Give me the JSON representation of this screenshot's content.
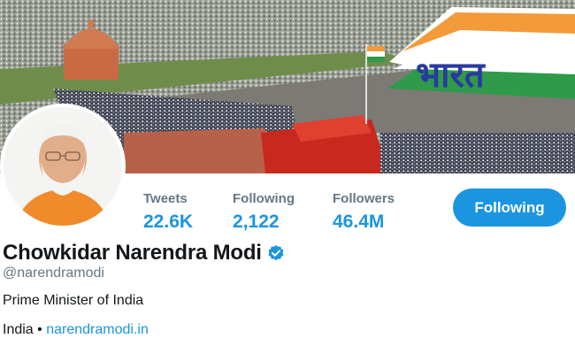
{
  "profile": {
    "display_name": "Chowkidar Narendra Modi",
    "handle": "@narendramodi",
    "bio": "Prime Minister of India",
    "location": "India",
    "separator": "•",
    "website": "narendramodi.in",
    "verified_icon": "verified-badge-icon",
    "banner_text": "भारत"
  },
  "stats": [
    {
      "label": "Tweets",
      "value": "22.6K"
    },
    {
      "label": "Following",
      "value": "2,122"
    },
    {
      "label": "Followers",
      "value": "46.4M"
    }
  ],
  "actions": {
    "follow_label": "Following"
  },
  "colors": {
    "accent": "#1b95e0",
    "muted": "#657786",
    "text": "#14171a"
  }
}
